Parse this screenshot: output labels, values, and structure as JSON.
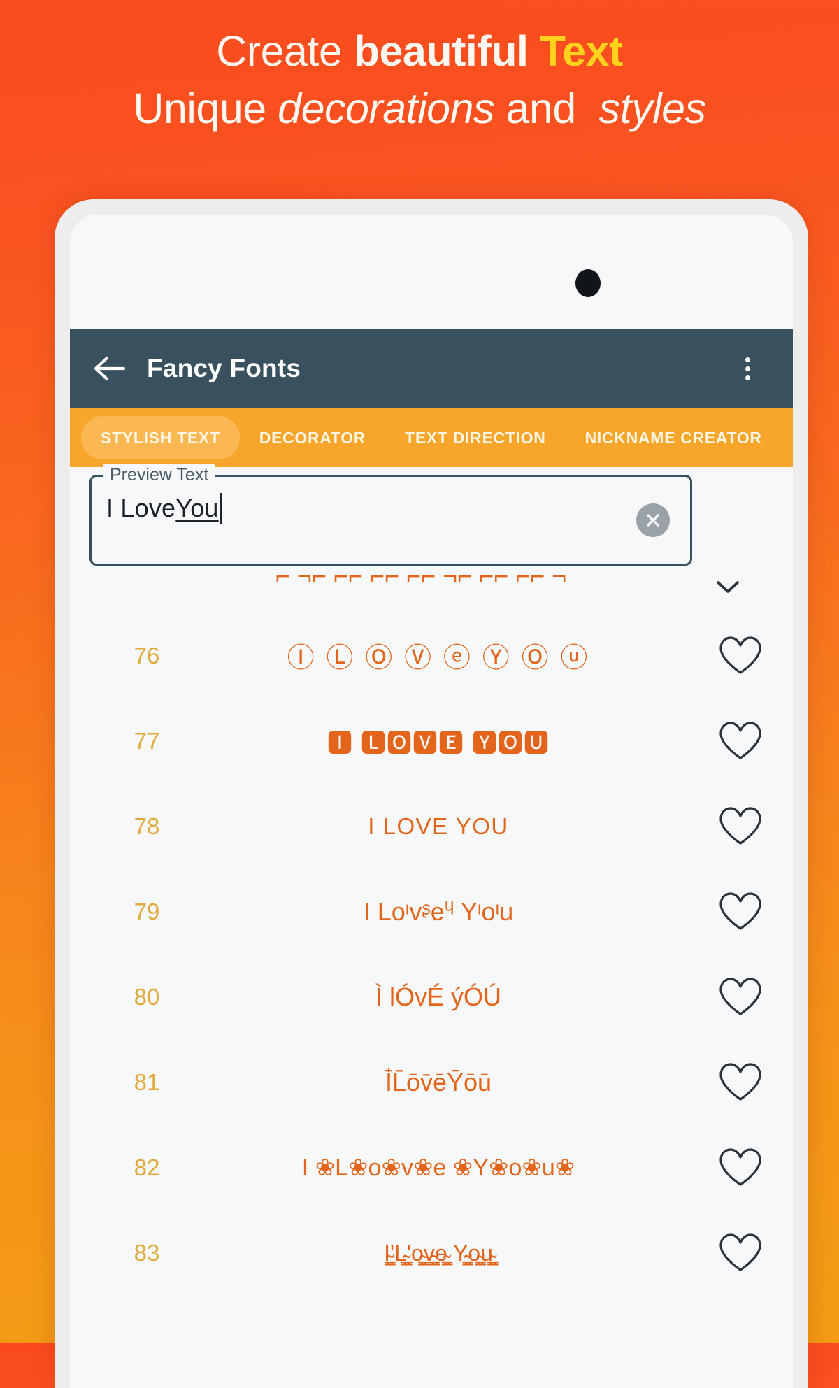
{
  "promo": {
    "line1_part1": "Create ",
    "line1_bold": "beautiful",
    "line1_accent": "Text",
    "line2_part1": "Unique ",
    "line2_italic1": "decorations",
    "line2_part2": " and ",
    "line2_italic2": "styles",
    "accent_color": "#FFD21E",
    "text_color": "#FFF8F0",
    "bg_top_color": "#FB4B1E",
    "bg_bottom_color": "#F39C14"
  },
  "appbar": {
    "title": "Fancy Fonts",
    "back_icon": "arrow-left-icon",
    "overflow_icon": "more-vertical-icon",
    "bg_color": "#39505F"
  },
  "tabs": {
    "bg_color": "#F7A62B",
    "active_pill_color": "#FBB852",
    "items": [
      {
        "label": "STYLISH TEXT",
        "active": true
      },
      {
        "label": "DECORATOR",
        "active": false
      },
      {
        "label": "TEXT DIRECTION",
        "active": false
      },
      {
        "label": "NICKNAME CREATOR",
        "active": false
      }
    ]
  },
  "preview_field": {
    "label": "Preview Text",
    "value_plain": "I Love ",
    "value_misspelled": "You",
    "placeholder": "Preview Text",
    "clear_icon": "clear-circle-icon",
    "border_color": "#39505F"
  },
  "font_list": {
    "index_color": "#E0A93B",
    "sample_color": "#E2651B",
    "heart_icon": "heart-outline-icon",
    "expand_icon": "chevron-down-icon",
    "partial_row_sample": "⌐ ¬⌐ ⌐⌐ ⌐⌐ ⌐⌐ ¬⌐ ⌐⌐ ⌐⌐ ¬",
    "rows": [
      {
        "index": "76",
        "sample": "Ⓘ Ⓛ Ⓞ Ⓥ ⓔ Ⓨ Ⓞ ⓤ",
        "style": "circled",
        "favorited": false
      },
      {
        "index": "77",
        "sample": "🅸 🅻🅾🆅🅴 🆈🅾🆄",
        "style": "boxed",
        "favorited": false
      },
      {
        "index": "78",
        "sample": "I LOVE YOU",
        "style": "caps",
        "favorited": false
      },
      {
        "index": "79",
        "sample": "I Loᶦvᶳeᶣ Yᶦoᶦu",
        "style": "diacritic",
        "favorited": false
      },
      {
        "index": "80",
        "sample": "Ì lÓvÉ ýÓÚ",
        "style": "diacritic",
        "favorited": false
      },
      {
        "index": "81",
        "sample": "Ī̍L̄ōv̄ēȲōū",
        "style": "diacritic",
        "favorited": false
      },
      {
        "index": "82",
        "sample": "I ❀L❀o❀v❀e ❀Y❀o❀u❀",
        "style": "flower",
        "favorited": false
      },
      {
        "index": "83",
        "sample": "I̴̬͇'L̴̬͇'o̴̬͇v̴̬͇e̴̬͇ Y̴̬͇o̴̬͇u̴̬͇",
        "style": "zalgo",
        "favorited": false
      }
    ]
  }
}
